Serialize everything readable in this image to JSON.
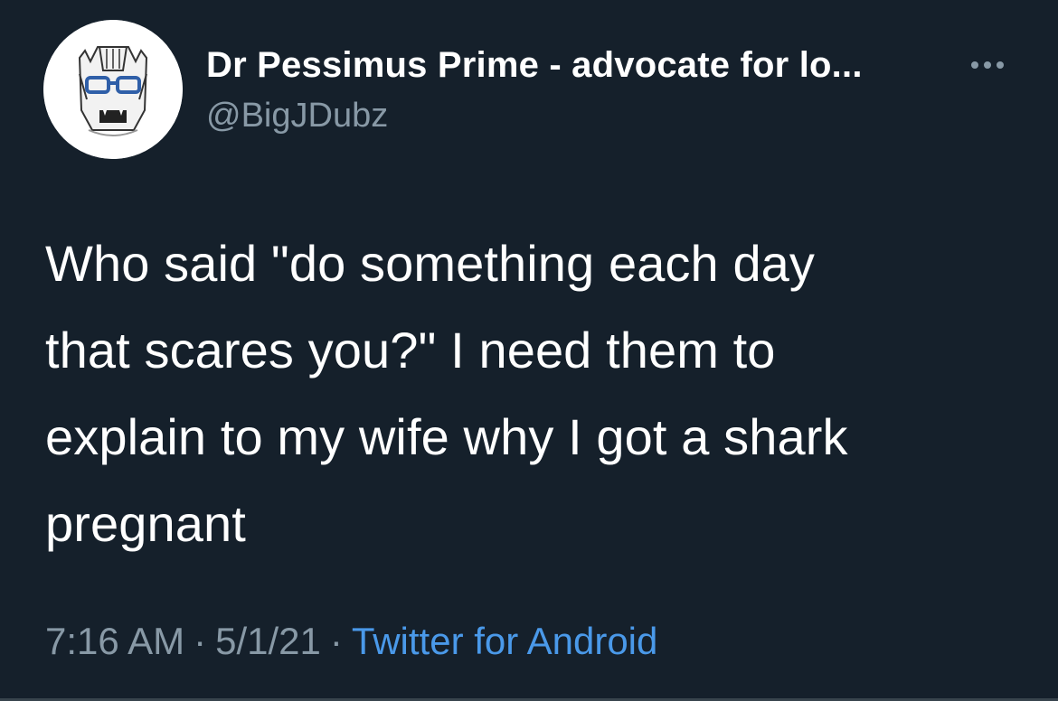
{
  "tweet": {
    "author": {
      "display_name": "Dr Pessimus Prime - advocate for lo...",
      "handle": "@BigJDubz",
      "avatar_icon": "robot-helmet-avatar-icon"
    },
    "more_icon": "more-options-icon",
    "text": "Who said \"do something each day\nthat scares you?\" I need them to\nexplain to my wife why I got a shark\npregnant",
    "time": "7:16 AM",
    "separator": "·",
    "date": "5/1/21",
    "source": "Twitter for Android"
  },
  "colors": {
    "background": "#15202b",
    "text": "#ffffff",
    "secondary_text": "#8899a6",
    "link": "#4a99e9"
  }
}
